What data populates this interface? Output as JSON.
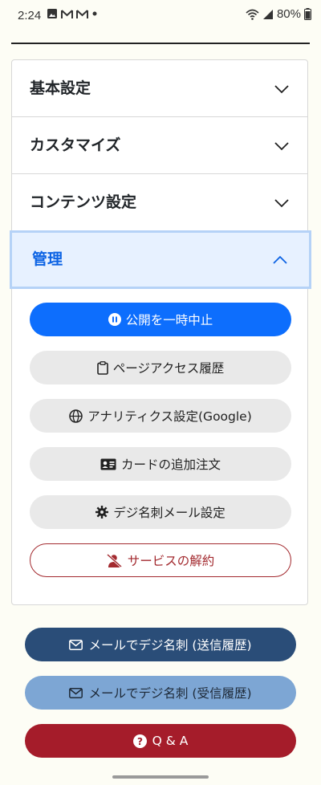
{
  "status_bar": {
    "time": "2:24",
    "battery": "80%"
  },
  "accordion": {
    "sections": [
      {
        "label": "基本設定",
        "expanded": false
      },
      {
        "label": "カスタマイズ",
        "expanded": false
      },
      {
        "label": "コンテンツ設定",
        "expanded": false
      },
      {
        "label": "管理",
        "expanded": true
      }
    ],
    "manage_buttons": {
      "pause": "公開を一時中止",
      "history": "ページアクセス履歴",
      "analytics": "アナリティクス設定(Google)",
      "card_order": "カードの追加注文",
      "mail_settings": "デジ名刺メール設定",
      "cancel": "サービスの解約"
    }
  },
  "bottom_actions": {
    "sent_history": "メールでデジ名刺 (送信履歴)",
    "received_history": "メールでデジ名刺 (受信履歴)",
    "qa": "Q & A"
  },
  "colors": {
    "primary": "#0d6efd",
    "open_header_bg": "#e7f1ff",
    "danger": "#a32a2f",
    "navy": "#2a4d78",
    "light_blue": "#7da6d4",
    "crimson": "#a51c2a"
  }
}
